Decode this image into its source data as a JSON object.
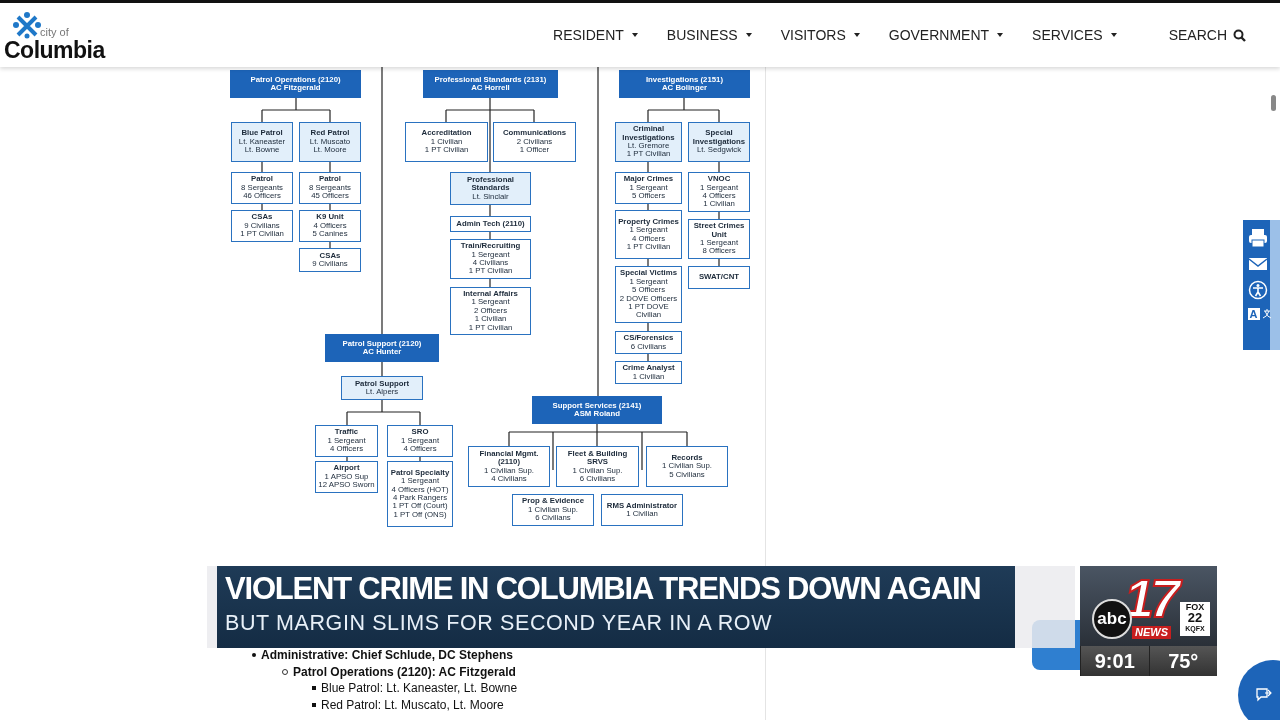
{
  "logo": {
    "small": "city of",
    "name": "Columbia"
  },
  "nav": {
    "items": [
      {
        "label": "RESIDENT",
        "has_menu": true
      },
      {
        "label": "BUSINESS",
        "has_menu": true
      },
      {
        "label": "VISITORS",
        "has_menu": true
      },
      {
        "label": "GOVERNMENT",
        "has_menu": true
      },
      {
        "label": "SERVICES",
        "has_menu": true
      }
    ],
    "search": "SEARCH"
  },
  "org_chart": {
    "nodes": [
      {
        "kind": "head",
        "title": "Patrol Operations (2120)",
        "lines": [
          "AC Fitzgerald"
        ]
      },
      {
        "kind": "head",
        "title": "Professional Standards (2131)",
        "lines": [
          "AC Horrell"
        ]
      },
      {
        "kind": "head",
        "title": "Investigations (2151)",
        "lines": [
          "AC Bolinger"
        ]
      },
      {
        "kind": "sub",
        "title": "Blue Patrol",
        "lines": [
          "Lt. Kaneaster",
          "Lt. Bowne"
        ]
      },
      {
        "kind": "sub",
        "title": "Red Patrol",
        "lines": [
          "Lt. Muscato",
          "Lt. Moore"
        ]
      },
      {
        "kind": "unit",
        "title": "Patrol",
        "lines": [
          "8 Sergeants",
          "46 Officers"
        ]
      },
      {
        "kind": "unit",
        "title": "Patrol",
        "lines": [
          "8 Sergeants",
          "45 Officers"
        ]
      },
      {
        "kind": "unit",
        "title": "CSAs",
        "lines": [
          "9 Civilians",
          "1 PT Civilian"
        ]
      },
      {
        "kind": "unit",
        "title": "K9 Unit",
        "lines": [
          "4 Officers",
          "5 Canines"
        ]
      },
      {
        "kind": "unit",
        "title": "CSAs",
        "lines": [
          "9 Civilians"
        ]
      },
      {
        "kind": "unit",
        "title": "Accreditation",
        "lines": [
          "1 Civilian",
          "1 PT Civilian"
        ]
      },
      {
        "kind": "unit",
        "title": "Communications",
        "lines": [
          "2 Civilians",
          "1 Officer"
        ]
      },
      {
        "kind": "sub",
        "title": "Professional Standards",
        "lines": [
          "Lt. Sinclair"
        ]
      },
      {
        "kind": "unit",
        "title": "Admin Tech (2110)"
      },
      {
        "kind": "unit",
        "title": "Train/Recruiting",
        "lines": [
          "1 Sergeant",
          "4 Civilians",
          "1 PT Civilian"
        ]
      },
      {
        "kind": "unit",
        "title": "Internal Affairs",
        "lines": [
          "1 Sergeant",
          "2 Officers",
          "1 Civilian",
          "1 PT Civilian"
        ]
      },
      {
        "kind": "sub",
        "title": "Criminal Investigations",
        "lines": [
          "Lt. Gremore",
          "1 PT Civilian"
        ]
      },
      {
        "kind": "sub",
        "title": "Special Investigations",
        "lines": [
          "Lt. Sedgwick"
        ]
      },
      {
        "kind": "unit",
        "title": "Major Crimes",
        "lines": [
          "1 Sergeant",
          "5 Officers"
        ]
      },
      {
        "kind": "unit",
        "title": "Property Crimes",
        "lines": [
          "1 Sergeant",
          "4 Officers",
          "1 PT Civilian"
        ]
      },
      {
        "kind": "unit",
        "title": "Special Victims",
        "lines": [
          "1 Sergeant",
          "5 Officers",
          "2 DOVE Officers",
          "1 PT DOVE Civilian"
        ]
      },
      {
        "kind": "unit",
        "title": "CS/Forensics",
        "lines": [
          "6 Civilians"
        ]
      },
      {
        "kind": "unit",
        "title": "Crime Analyst",
        "lines": [
          "1 Civilian"
        ]
      },
      {
        "kind": "unit",
        "title": "VNOC",
        "lines": [
          "1 Sergeant",
          "4 Officers",
          "1 Civilian"
        ]
      },
      {
        "kind": "unit",
        "title": "Street Crimes Unit",
        "lines": [
          "1 Sergeant",
          "8 Officers"
        ]
      },
      {
        "kind": "unit",
        "title": "SWAT/CNT"
      },
      {
        "kind": "head",
        "title": "Patrol Support (2120)",
        "lines": [
          "AC Hunter"
        ]
      },
      {
        "kind": "sub",
        "title": "Patrol Support",
        "lines": [
          "Lt. Alpers"
        ]
      },
      {
        "kind": "unit",
        "title": "Traffic",
        "lines": [
          "1 Sergeant",
          "4 Officers"
        ]
      },
      {
        "kind": "unit",
        "title": "SRO",
        "lines": [
          "1 Sergeant",
          "4 Officers"
        ]
      },
      {
        "kind": "unit",
        "title": "Airport",
        "lines": [
          "1 APSO Sup",
          "12 APSO Sworn"
        ]
      },
      {
        "kind": "unit",
        "title": "Patrol Specialty",
        "lines": [
          "1 Sergeant",
          "4 Officers (HOT)",
          "4 Park Rangers",
          "1 PT Off (Court)",
          "1 PT Off (ONS)"
        ]
      },
      {
        "kind": "head",
        "title": "Support Services (2141)",
        "lines": [
          "ASM Roland"
        ]
      },
      {
        "kind": "unit",
        "title": "Financial Mgmt. (2110)",
        "lines": [
          "1 Civilian Sup.",
          "4 Civilians"
        ]
      },
      {
        "kind": "unit",
        "title": "Fleet & Building SRVS",
        "lines": [
          "1 Civilian Sup.",
          "6 Civilians"
        ]
      },
      {
        "kind": "unit",
        "title": "Records",
        "lines": [
          "1 Civilian Sup.",
          "5 Civilians"
        ]
      },
      {
        "kind": "unit",
        "title": "Prop & Evidence",
        "lines": [
          "1 Civilian Sup.",
          "6 Civilians"
        ]
      },
      {
        "kind": "unit",
        "title": "RMS Administrator",
        "lines": [
          "1 Civilian"
        ]
      }
    ]
  },
  "outline": [
    {
      "text": "Administrative: Chief Schlude, DC Stephens",
      "bold": true,
      "children": [
        {
          "text": "Patrol Operations (2120): AC Fitzgerald",
          "bold": true,
          "children": [
            {
              "text": "Blue Patrol: Lt. Kaneaster, Lt. Bowne",
              "bold": false
            },
            {
              "text": "Red Patrol: Lt. Muscato, Lt. Moore",
              "bold": false
            }
          ]
        }
      ]
    }
  ],
  "side_tools": {
    "font_label": "A"
  },
  "broadcast": {
    "headline": "VIOLENT CRIME IN COLUMBIA TRENDS DOWN AGAIN",
    "subheadline": "BUT MARGIN SLIMS FOR SECOND YEAR IN A ROW",
    "station": {
      "network": "abc",
      "channel": "17",
      "brand": "NEWS",
      "affiliate": "FOX",
      "affiliate_channel": "22",
      "callsign": "KQFX"
    },
    "time": "9:01",
    "temperature": "75°"
  }
}
